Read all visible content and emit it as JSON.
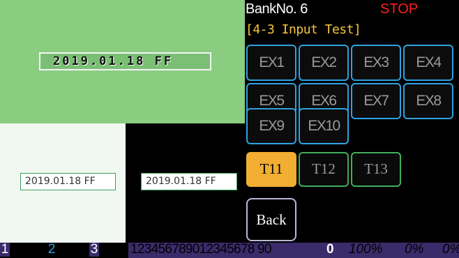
{
  "preview": {
    "pixel_date": "2019.01.18 FF",
    "date_white": "2019.01.18 FF",
    "date_black": "2019.01.18 FF"
  },
  "header": {
    "bank_label": "BankNo. 6",
    "status": "STOP",
    "screen_title": "[4-3 Input Test]"
  },
  "ex_buttons": [
    "EX1",
    "EX2",
    "EX3",
    "EX4",
    "EX5",
    "EX6",
    "EX7",
    "EX8",
    "EX9",
    "EX10"
  ],
  "t_buttons": [
    "T11",
    "T12",
    "T13"
  ],
  "active_t": "T11",
  "back_label": "Back",
  "status_bar": {
    "slot1": "1",
    "slot2": "2",
    "slot3": "3",
    "sequence": "123456789012345678 90",
    "count": "0",
    "percent": "100%",
    "zero1": "0%",
    "zero2": "0%"
  },
  "colors": {
    "accent_active": "#f2ae32",
    "ex_border": "#2fa2e0",
    "t_border": "#3fae5c",
    "stop": "#ff1f1f",
    "title": "#f7c63e"
  }
}
